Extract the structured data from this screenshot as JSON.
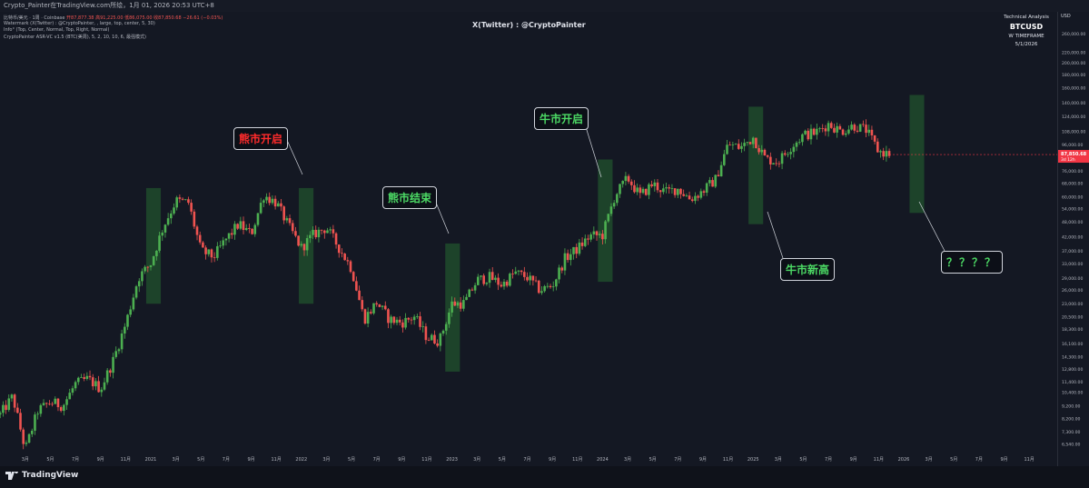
{
  "header": {
    "title": "Crypto_Painter在TradingView.com所绘，1月 01, 2026 20:53 UTC+8"
  },
  "indicators": {
    "line1_symbol": "比特币/美元 · 1周 · Coinbase",
    "line1_open": "开87,877.38",
    "line1_high": "高91,225.00",
    "line1_low": "低86,075.00",
    "line1_close": "收87,850.68",
    "line1_change": "−26.61 (−0.03%)",
    "line2": "Watermark (X(Twitter) : @CryptoPainter, , large, top, center, 5, 30)",
    "line3": "Info° (Top, Center, Normal, Top, Right, Normal)",
    "line4": "CryptoPainter ASR-VC v1.5 (BTC(美周), 5, 2, 10, 10, 6, 最强模式)"
  },
  "watermark": "X(Twitter) : @CryptoPainter",
  "info_box": {
    "title": "Technical Analysis",
    "symbol": "BTCUSD",
    "timeframe": "W TIMEFRAME",
    "date": "5/1/2026"
  },
  "price_scale": {
    "currency": "USD",
    "current_price": "87,850.68",
    "countdown": "3d 12h"
  },
  "annotations": [
    {
      "id": "bear-start",
      "text": "熊市开启",
      "color": "red"
    },
    {
      "id": "bear-end",
      "text": "熊市结束",
      "color": "green"
    },
    {
      "id": "bull-start",
      "text": "牛市开启",
      "color": "green"
    },
    {
      "id": "bull-new-high",
      "text": "牛市新高",
      "color": "green"
    },
    {
      "id": "unknown",
      "text": "？？？？",
      "color": "green"
    }
  ],
  "branding": {
    "logo_text": "TradingView"
  },
  "colors": {
    "up": "#26a69a",
    "up_candle": "#4caf50",
    "down": "#ef5350",
    "background": "#141823",
    "zone": "#1e4b2c",
    "price_tag": "#f23645"
  },
  "chart_data": {
    "type": "candlestick",
    "timeframe": "1W",
    "symbol": "BTCUSD",
    "scale": "log",
    "ylim": [
      5800,
      280000
    ],
    "y_ticks": [
      "260,000.00",
      "220,000.00",
      "200,000.00",
      "180,000.00",
      "160,000.00",
      "140,000.00",
      "124,000.00",
      "108,000.00",
      "96,000.00",
      "86,000.00",
      "76,000.00",
      "68,000.00",
      "60,000.00",
      "54,000.00",
      "48,000.00",
      "42,000.00",
      "37,000.00",
      "33,000.00",
      "29,000.00",
      "26,000.00",
      "23,000.00",
      "20,500.00",
      "18,300.00",
      "16,100.00",
      "14,300.00",
      "12,800.00",
      "11,400.00",
      "10,400.00",
      "9,200.00",
      "8,200.00",
      "7,300.00",
      "6,540.00"
    ],
    "x_ticks": [
      "3月",
      "5月",
      "7月",
      "9月",
      "11月",
      "2021",
      "3月",
      "5月",
      "7月",
      "9月",
      "11月",
      "2022",
      "3月",
      "5月",
      "7月",
      "9月",
      "11月",
      "2023",
      "3月",
      "5月",
      "7月",
      "9月",
      "11月",
      "2024",
      "3月",
      "5月",
      "7月",
      "9月",
      "11月",
      "2025",
      "3月",
      "5月",
      "7月",
      "9月",
      "11月",
      "2026",
      "3月",
      "5月",
      "7月",
      "9月",
      "11月"
    ],
    "x_range": [
      "2020-01",
      "2026-12"
    ],
    "price_path": [
      [
        "2020-01",
        8500
      ],
      [
        "2020-02",
        10000
      ],
      [
        "2020-03",
        6200
      ],
      [
        "2020-04",
        8800
      ],
      [
        "2020-05",
        9500
      ],
      [
        "2020-06",
        9200
      ],
      [
        "2020-07",
        11200
      ],
      [
        "2020-08",
        11700
      ],
      [
        "2020-09",
        10700
      ],
      [
        "2020-10",
        13800
      ],
      [
        "2020-11",
        19200
      ],
      [
        "2020-12",
        29000
      ],
      [
        "2021-01",
        33000
      ],
      [
        "2021-02",
        46000
      ],
      [
        "2021-03",
        58000
      ],
      [
        "2021-04",
        57000
      ],
      [
        "2021-05",
        37000
      ],
      [
        "2021-06",
        35000
      ],
      [
        "2021-07",
        41000
      ],
      [
        "2021-08",
        47000
      ],
      [
        "2021-09",
        43000
      ],
      [
        "2021-10",
        61000
      ],
      [
        "2021-11",
        57000
      ],
      [
        "2021-12",
        46000
      ],
      [
        "2022-01",
        38000
      ],
      [
        "2022-02",
        43000
      ],
      [
        "2022-03",
        45500
      ],
      [
        "2022-04",
        38000
      ],
      [
        "2022-05",
        31500
      ],
      [
        "2022-06",
        20000
      ],
      [
        "2022-07",
        23300
      ],
      [
        "2022-08",
        20000
      ],
      [
        "2022-09",
        19400
      ],
      [
        "2022-10",
        20500
      ],
      [
        "2022-11",
        17000
      ],
      [
        "2022-12",
        16500
      ],
      [
        "2023-01",
        23000
      ],
      [
        "2023-02",
        23100
      ],
      [
        "2023-03",
        28400
      ],
      [
        "2023-04",
        29200
      ],
      [
        "2023-05",
        27200
      ],
      [
        "2023-06",
        30400
      ],
      [
        "2023-07",
        29200
      ],
      [
        "2023-08",
        26000
      ],
      [
        "2023-09",
        27000
      ],
      [
        "2023-10",
        34500
      ],
      [
        "2023-11",
        37700
      ],
      [
        "2023-12",
        42300
      ],
      [
        "2024-01",
        42600
      ],
      [
        "2024-02",
        61000
      ],
      [
        "2024-03",
        71000
      ],
      [
        "2024-04",
        60600
      ],
      [
        "2024-05",
        67500
      ],
      [
        "2024-06",
        62700
      ],
      [
        "2024-07",
        64600
      ],
      [
        "2024-08",
        58900
      ],
      [
        "2024-09",
        63300
      ],
      [
        "2024-10",
        70200
      ],
      [
        "2024-11",
        96400
      ],
      [
        "2024-12",
        93400
      ],
      [
        "2025-01",
        102400
      ],
      [
        "2025-02",
        84300
      ],
      [
        "2025-03",
        82500
      ],
      [
        "2025-04",
        94200
      ],
      [
        "2025-05",
        104600
      ],
      [
        "2025-06",
        107100
      ],
      [
        "2025-07",
        115700
      ],
      [
        "2025-08",
        108200
      ],
      [
        "2025-09",
        114000
      ],
      [
        "2025-10",
        109500
      ],
      [
        "2025-11",
        90400
      ],
      [
        "2025-12",
        87850
      ]
    ],
    "highlight_zones": [
      {
        "from": "2020-12-20",
        "to": "2021-01-25",
        "low": 23000,
        "high": 65000
      },
      {
        "from": "2021-12-25",
        "to": "2022-01-30",
        "low": 23000,
        "high": 65000
      },
      {
        "from": "2022-12-15",
        "to": "2023-01-20",
        "low": 12500,
        "high": 39500
      },
      {
        "from": "2023-12-20",
        "to": "2024-01-25",
        "low": 28000,
        "high": 84000
      },
      {
        "from": "2024-12-20",
        "to": "2025-01-25",
        "low": 47000,
        "high": 135000
      },
      {
        "from": "2026-01-15",
        "to": "2026-02-20",
        "low": 52000,
        "high": 150000
      }
    ]
  }
}
